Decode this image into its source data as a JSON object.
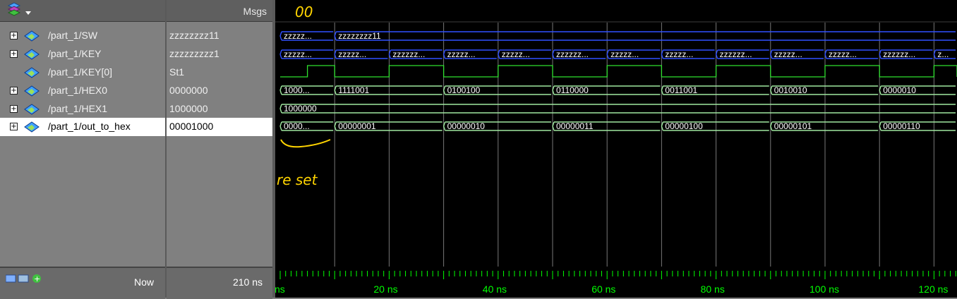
{
  "toolbar": {
    "menu_icon": "wave-layers-icon",
    "dropdown_icon": "chevron-down-icon"
  },
  "columns": {
    "msgs_header": "Msgs"
  },
  "signals": [
    {
      "name": "/part_1/SW",
      "value": "zzzzzzzz11",
      "expandable": true,
      "icon": "bus-icon"
    },
    {
      "name": "/part_1/KEY",
      "value": "zzzzzzzzz1",
      "expandable": true,
      "icon": "bus-icon"
    },
    {
      "name": "/part_1/KEY[0]",
      "value": "St1",
      "expandable": false,
      "icon": "signal-icon"
    },
    {
      "name": "/part_1/HEX0",
      "value": "0000000",
      "expandable": true,
      "icon": "bus-icon"
    },
    {
      "name": "/part_1/HEX1",
      "value": "1000000",
      "expandable": true,
      "icon": "bus-icon"
    },
    {
      "name": "/part_1/out_to_hex",
      "value": "00001000",
      "expandable": true,
      "icon": "bus-icon",
      "selected": true
    }
  ],
  "footer": {
    "now_label": "Now",
    "now_value": "210 ns"
  },
  "waves": {
    "sw": {
      "labels": [
        "zzzzz...",
        "zzzzzzzz11"
      ]
    },
    "key": {
      "labels": [
        "zzzzz...",
        "zzzzz...",
        "zzzzzz...",
        "zzzzz...",
        "zzzzz...",
        "zzzzzz...",
        "zzzzz...",
        "zzzzz...",
        "zzzzzz...",
        "zzzzz...",
        "zzzzz...",
        "zzzzzz...",
        "z..."
      ]
    },
    "hex0": {
      "labels": [
        "1000...",
        "1111001",
        "0100100",
        "0110000",
        "0011001",
        "0010010",
        "0000010"
      ]
    },
    "hex1": {
      "labels": [
        "1000000"
      ]
    },
    "out": {
      "labels": [
        "0000...",
        "00000001",
        "00000010",
        "00000011",
        "00000100",
        "00000101",
        "00000110"
      ]
    },
    "key0_toggle_ns": [
      5,
      10,
      20,
      30,
      40,
      50,
      60,
      70,
      80,
      90,
      100,
      110,
      120,
      130
    ]
  },
  "timeline": {
    "ticks": [
      "ns",
      "20 ns",
      "40 ns",
      "60 ns",
      "80 ns",
      "100 ns",
      "120 ns"
    ],
    "visible_range_ns": [
      0,
      125
    ]
  },
  "annotations": {
    "top": "00",
    "reset": "re set"
  }
}
